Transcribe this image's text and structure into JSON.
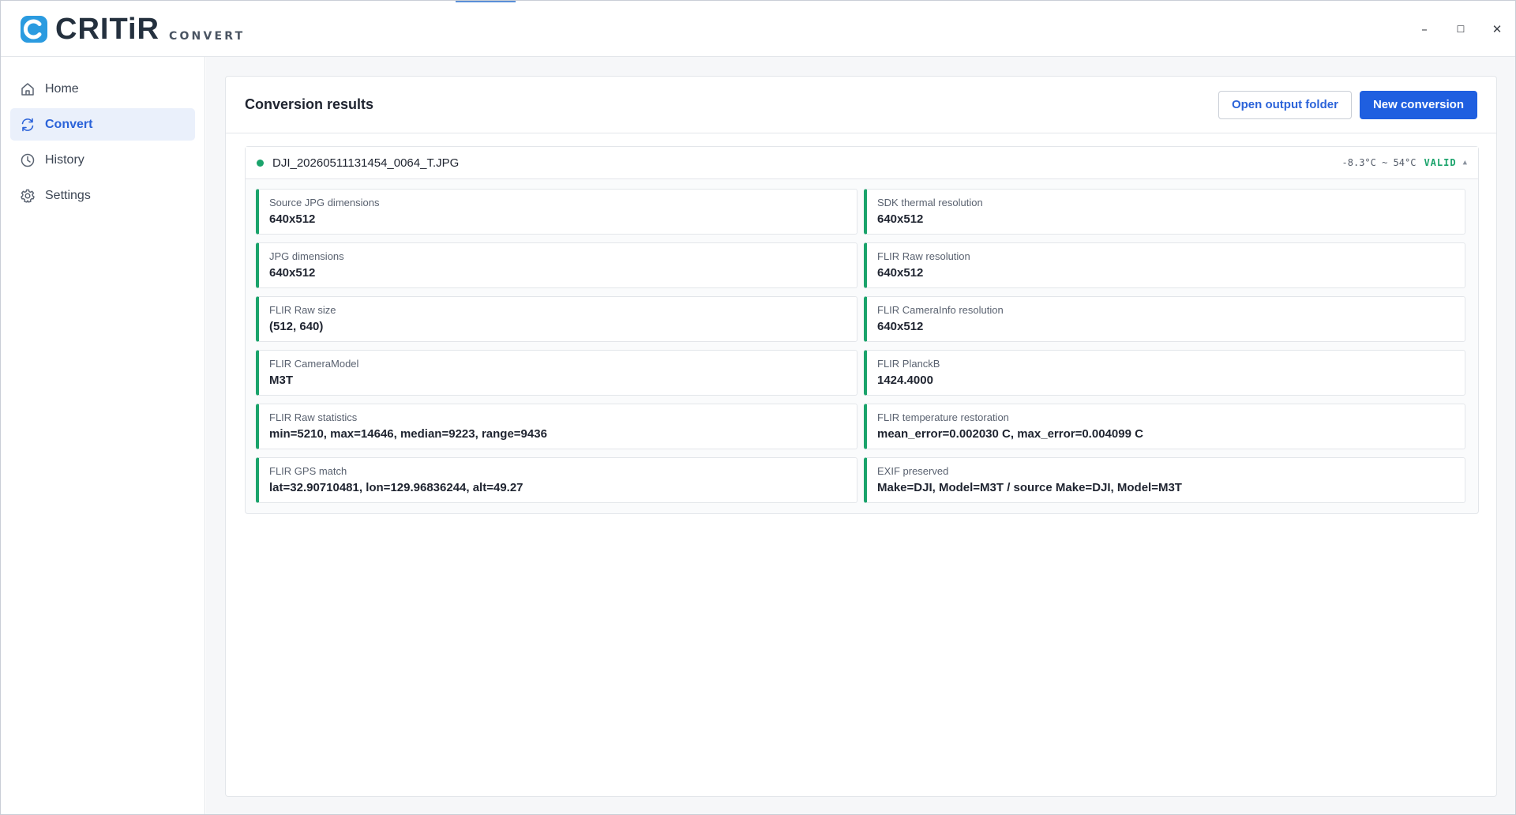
{
  "app": {
    "logo_text": "CRITiR",
    "logo_sub": "CONVERT",
    "brand_color": "#2b9be0"
  },
  "window_controls": {
    "minimize": "–",
    "maximize": "☐",
    "close": "✕"
  },
  "sidebar": {
    "items": [
      {
        "label": "Home",
        "icon": "home-icon",
        "active": false
      },
      {
        "label": "Convert",
        "icon": "refresh-icon",
        "active": true
      },
      {
        "label": "History",
        "icon": "clock-icon",
        "active": false
      },
      {
        "label": "Settings",
        "icon": "gear-icon",
        "active": false
      }
    ]
  },
  "panel": {
    "title": "Conversion results",
    "open_folder_label": "Open output folder",
    "new_conversion_label": "New conversion"
  },
  "file": {
    "name": "DJI_20260511131454_0064_T.JPG",
    "temp_range": "-8.3°C ~ 54°C",
    "status": "VALID",
    "status_color": "#1aa36b",
    "expand_icon": "caret-up-icon"
  },
  "results": [
    {
      "label": "Source JPG dimensions",
      "value": "640x512"
    },
    {
      "label": "SDK thermal resolution",
      "value": "640x512"
    },
    {
      "label": "JPG dimensions",
      "value": "640x512"
    },
    {
      "label": "FLIR Raw resolution",
      "value": "640x512"
    },
    {
      "label": "FLIR Raw size",
      "value": "(512, 640)"
    },
    {
      "label": "FLIR CameraInfo resolution",
      "value": "640x512"
    },
    {
      "label": "FLIR CameraModel",
      "value": "M3T"
    },
    {
      "label": "FLIR PlanckB",
      "value": "1424.4000"
    },
    {
      "label": "FLIR Raw statistics",
      "value": "min=5210, max=14646, median=9223, range=9436"
    },
    {
      "label": "FLIR temperature restoration",
      "value": "mean_error=0.002030 C, max_error=0.004099 C"
    },
    {
      "label": "FLIR GPS match",
      "value": "lat=32.90710481, lon=129.96836244, alt=49.27"
    },
    {
      "label": "EXIF preserved",
      "value": "Make=DJI, Model=M3T / source Make=DJI, Model=M3T"
    }
  ]
}
